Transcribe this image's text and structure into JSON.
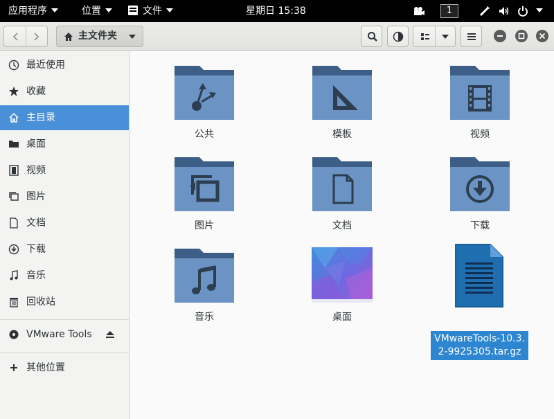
{
  "topbar": {
    "apps_menu": "应用程序",
    "places_menu": "位置",
    "app_menu": "文件",
    "clock": "星期日 15:38",
    "workspace": "1"
  },
  "headerbar": {
    "path_label": "主文件夹"
  },
  "sidebar": {
    "items": [
      {
        "label": "最近使用",
        "icon": "clock-icon"
      },
      {
        "label": "收藏",
        "icon": "star-icon"
      },
      {
        "label": "主目录",
        "icon": "home-icon"
      },
      {
        "label": "桌面",
        "icon": "folder-icon"
      },
      {
        "label": "视频",
        "icon": "film-icon"
      },
      {
        "label": "图片",
        "icon": "picture-icon"
      },
      {
        "label": "文档",
        "icon": "document-icon"
      },
      {
        "label": "下载",
        "icon": "download-icon"
      },
      {
        "label": "音乐",
        "icon": "music-icon"
      },
      {
        "label": "回收站",
        "icon": "trash-icon"
      }
    ],
    "device": "VMware Tools",
    "other_locations": "其他位置"
  },
  "files": [
    {
      "name": "公共",
      "icon": "public-folder-icon"
    },
    {
      "name": "模板",
      "icon": "templates-folder-icon"
    },
    {
      "name": "视频",
      "icon": "videos-folder-icon"
    },
    {
      "name": "图片",
      "icon": "pictures-folder-icon"
    },
    {
      "name": "文档",
      "icon": "documents-folder-icon"
    },
    {
      "name": "下载",
      "icon": "downloads-folder-icon"
    },
    {
      "name": "音乐",
      "icon": "music-folder-icon"
    },
    {
      "name": "桌面",
      "icon": "desktop-folder-icon"
    },
    {
      "name": "VMwareTools-10.3.2-9925305.tar.gz",
      "icon": "archive-file-icon"
    }
  ],
  "colors": {
    "selection": "#2e86d0",
    "folder": "#6b93c4",
    "folder_dark": "#3d5f87"
  }
}
